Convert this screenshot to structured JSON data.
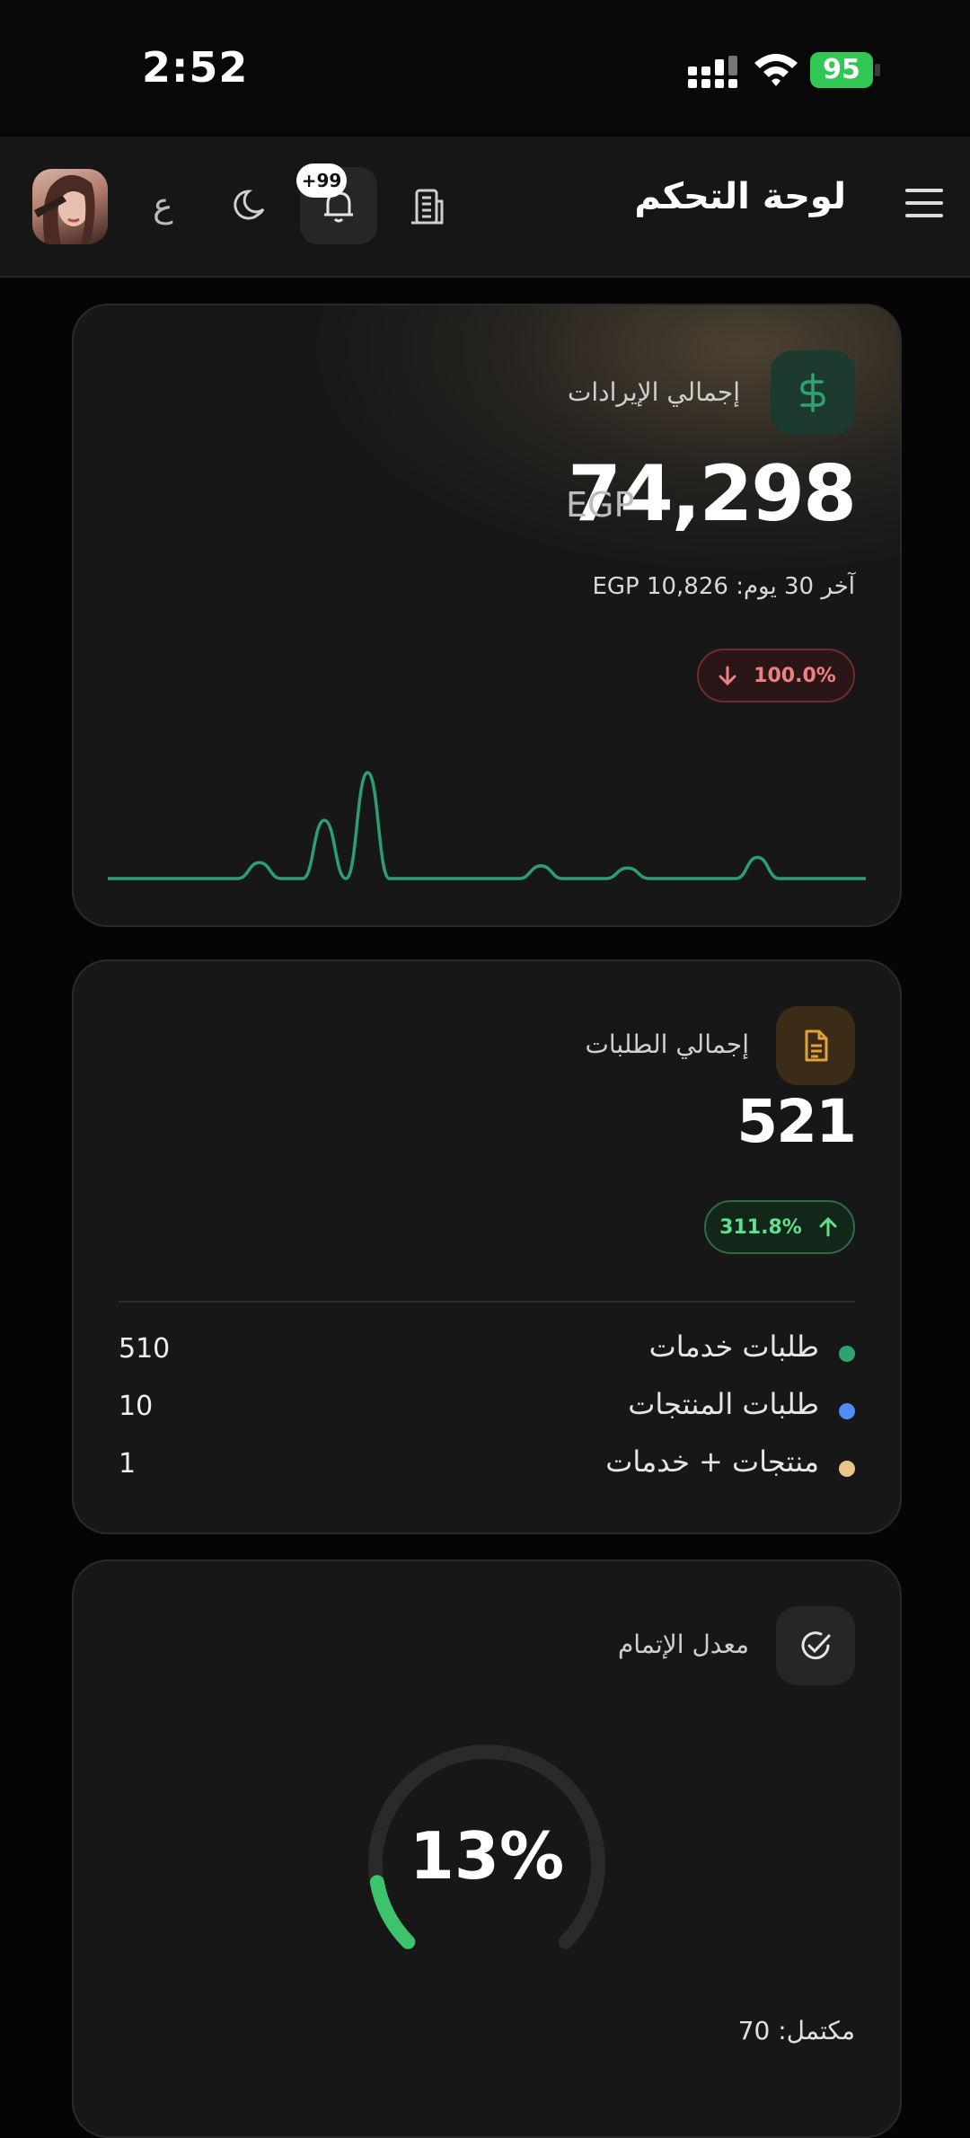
{
  "status": {
    "time": "2:52",
    "battery": "95"
  },
  "header": {
    "title": "لوحة التحكم",
    "notifications_badge": "+99",
    "lang_label": "ع"
  },
  "revenue": {
    "label": "إجمالي الإيرادات",
    "value": "74,298",
    "currency": "EGP",
    "last30_label": "آخر 30 يوم:",
    "last30_value": "EGP 10,826",
    "change": "100.0%",
    "change_direction": "down",
    "sparkline": [
      0,
      0,
      0,
      0,
      0,
      0,
      0,
      0.15,
      0,
      0,
      0.55,
      0,
      1.0,
      0,
      0,
      0,
      0,
      0,
      0,
      0,
      0.12,
      0,
      0,
      0,
      0.1,
      0,
      0,
      0,
      0,
      0,
      0.2,
      0,
      0,
      0,
      0,
      0
    ],
    "line_color": "#2e9e70"
  },
  "orders": {
    "label": "إجمالي الطلبات",
    "value": "521",
    "change": "311.8%",
    "change_direction": "up",
    "breakdown": [
      {
        "label": "طلبات خدمات",
        "value": "510",
        "color": "#2ea36f"
      },
      {
        "label": "طلبات المنتجات",
        "value": "10",
        "color": "#4f8ef7"
      },
      {
        "label": "منتجات + خدمات",
        "value": "1",
        "color": "#e8c58a"
      }
    ]
  },
  "completion": {
    "label": "معدل الإتمام",
    "percent_text": "13%",
    "percent": 13,
    "completed_label": "مكتمل:",
    "completed_value": "70",
    "accent": "#3cc36b"
  }
}
